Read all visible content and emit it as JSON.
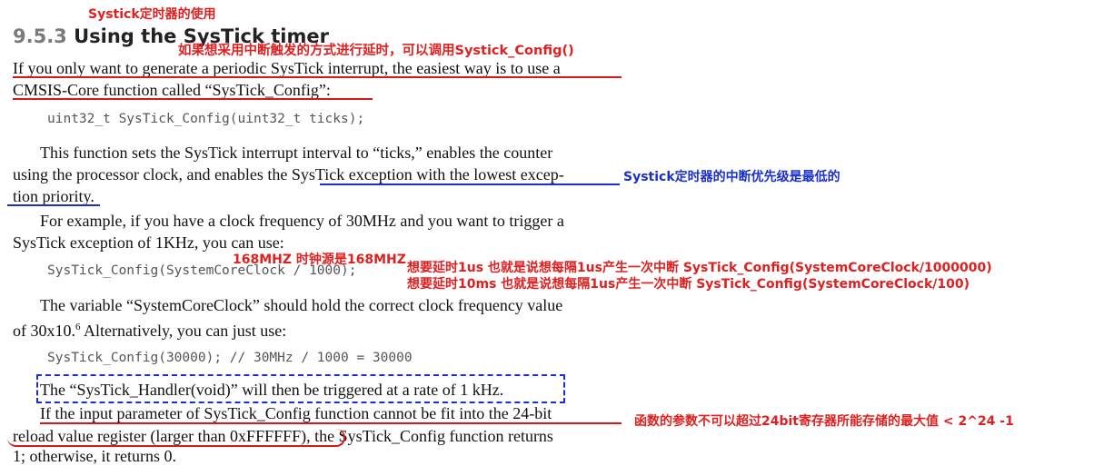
{
  "annotation_title": "Systick定时器的使用",
  "section": {
    "number": "9.5.3",
    "title": "Using the SysTick timer"
  },
  "annotations": {
    "interrupt_delay": "如果想采用中断触发的方式进行延时，可以调用Systick_Config()",
    "lowest_priority": "Systick定时器的中断优先级是最低的",
    "clock_168": "168MHZ  时钟源是168MHZ",
    "delay_1us": "想要延时1us    也就是说想每隔1us产生一次中断  SysTick_Config(SystemCoreClock/1000000)",
    "delay_10ms": "想要延时10ms   也就是说想每隔1us产生一次中断  SysTick_Config(SystemCoreClock/100)",
    "max_value": "函数的参数不可以超过24bit寄存器所能存储的最大值  < 2^24 -1"
  },
  "paragraphs": {
    "p1_line1": "If you only want to generate a periodic SysTick interrupt, the easiest way is to use a",
    "p1_line2": "CMSIS-Core function called “SysTick_Config”:",
    "code1": "uint32_t SysTick_Config(uint32_t ticks);",
    "p2_line1": "This function sets the SysTick interrupt interval to “ticks,” enables the counter",
    "p2_line2": "using the processor clock, and enables the SysTick exception with the lowest excep-",
    "p2_line3": "tion priority.",
    "p3_line1": "For example, if you have a clock frequency of 30MHz and you want to trigger a",
    "p3_line2": "SysTick exception of 1KHz, you can use:",
    "code2": "SysTick_Config(SystemCoreClock / 1000);",
    "p4_line1": "The variable “SystemCoreClock” should hold the correct clock frequency value",
    "p4_line2_a": "of 30x10.",
    "p4_line2_sup": "6",
    "p4_line2_b": " Alternatively, you can just use:",
    "code3": "SysTick_Config(30000); // 30MHz / 1000 = 30000",
    "p5_line1": "The “SysTick_Handler(void)” will then be triggered at a rate of 1 kHz.",
    "p6_line1": "If the input parameter of SysTick_Config function cannot be fit into the 24-bit",
    "p6_line2": "reload value register (larger than 0xFFFFFF), the SysTick_Config function returns",
    "p6_line3": "1; otherwise, it returns 0."
  },
  "colors": {
    "annotation_red": "#e02020",
    "annotation_blue": "#1a2fd0",
    "heading_number": "#7a7a7a"
  }
}
